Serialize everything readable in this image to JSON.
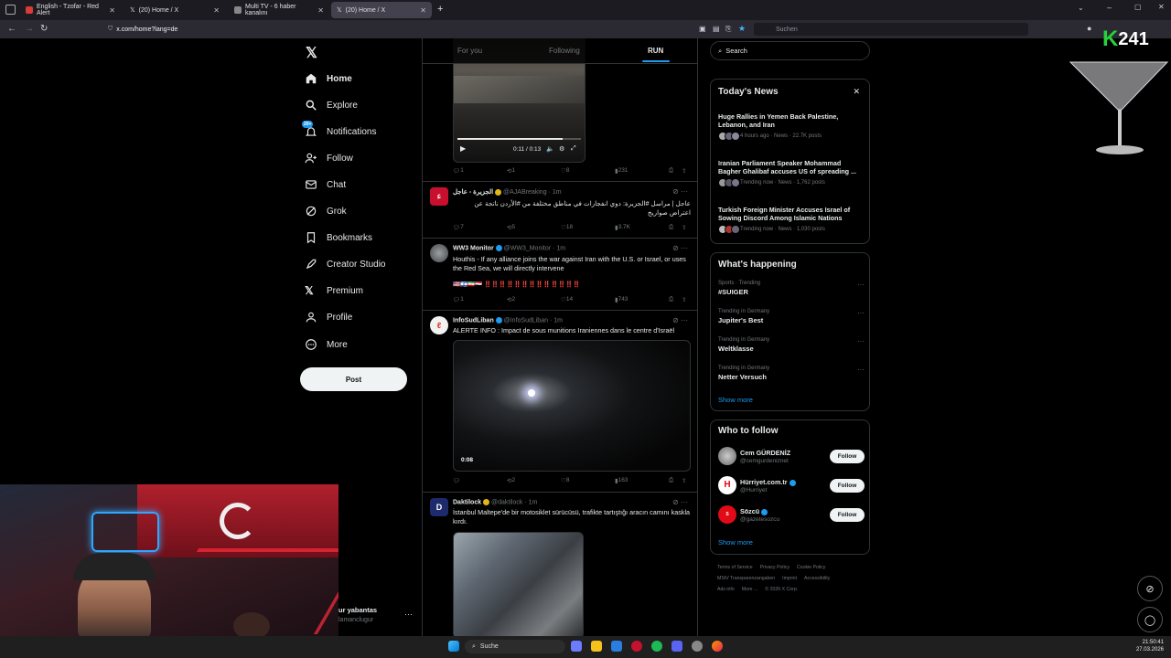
{
  "browser": {
    "tabs": [
      {
        "title": "English - Tzofar - Red Alert",
        "favicon_color": "#d93a3a"
      },
      {
        "title": "(20) Home / X",
        "favicon_color": "#ffffff"
      },
      {
        "title": "Multi TV - 6 haber kanalını",
        "favicon_color": "#888888"
      },
      {
        "title": "(20) Home / X",
        "favicon_color": "#ffffff"
      }
    ],
    "url": "x.com/home?lang=de",
    "search_placeholder": "Suchen"
  },
  "nav": {
    "items": [
      {
        "label": "Home",
        "icon": "home-icon"
      },
      {
        "label": "Explore",
        "icon": "search-icon"
      },
      {
        "label": "Notifications",
        "icon": "bell-icon",
        "badge": "20+"
      },
      {
        "label": "Follow",
        "icon": "add-user-icon"
      },
      {
        "label": "Chat",
        "icon": "mail-icon"
      },
      {
        "label": "Grok",
        "icon": "grok-icon"
      },
      {
        "label": "Bookmarks",
        "icon": "bookmark-icon"
      },
      {
        "label": "Creator Studio",
        "icon": "rocket-icon"
      },
      {
        "label": "Premium",
        "icon": "x-logo-icon"
      },
      {
        "label": "Profile",
        "icon": "profile-icon"
      },
      {
        "label": "More",
        "icon": "more-circle-icon"
      }
    ],
    "post_label": "Post",
    "account_name": "ur yabantas",
    "account_handle": "lamanclugur"
  },
  "feed": {
    "tabs": [
      "For you",
      "Following",
      "RUN"
    ],
    "tweet0": {
      "video_time": "0:11 / 0:13",
      "replies": "1",
      "reposts": "1",
      "likes": "8",
      "views": "231"
    },
    "tweet1": {
      "name": "الجزيرة - عاجل",
      "handle": "@AJABreaking",
      "time": "1m",
      "text": "عاجل | مراسل #الجزيرة: دوي انفجارات في مناطق مختلفة من #الأردن ناتجة عن اعتراض صواريخ",
      "replies": "7",
      "reposts": "5",
      "likes": "18",
      "views": "3.7K"
    },
    "tweet2": {
      "name": "WW3 Monitor",
      "handle": "@WW3_Monitor",
      "time": "1m",
      "text": "Houthis - If any alliance joins the war against Iran with the U.S. or Israel, or uses the Red Sea, we will directly intervene",
      "emojis": "🇺🇸🇮🇱🇮🇷🇾🇪 ‼️‼️‼️‼️‼️‼️‼️‼️‼️‼️‼️‼️‼️",
      "replies": "1",
      "reposts": "2",
      "likes": "14",
      "views": "743"
    },
    "tweet3": {
      "name": "InfoSudLiban",
      "handle": "@InfoSudLiban",
      "time": "1m",
      "text": "ALERTE INFO : Impact de sous munitions Iraniennes dans le centre d'Israël",
      "video_duration": "0:08",
      "replies": "",
      "reposts": "2",
      "likes": "8",
      "views": "163"
    },
    "tweet4": {
      "name": "Daktilock",
      "handle": "@daktilock",
      "time": "1m",
      "text": "İstanbul Maltepe'de bir motosiklet sürücüsü, trafikte tartıştığı aracın camını kaskla kırdı."
    }
  },
  "right": {
    "search_placeholder": "Search",
    "news": {
      "title": "Today's News",
      "items": [
        {
          "title": "Huge Rallies in Yemen Back Palestine, Lebanon, and Iran",
          "meta": "4 hours ago · News · 22.7K posts"
        },
        {
          "title": "Iranian Parliament Speaker Mohammad Bagher Ghalibaf accuses US of spreading ...",
          "meta": "Trending now · News · 1,762 posts"
        },
        {
          "title": "Turkish Foreign Minister Accuses Israel of Sowing Discord Among Islamic Nations",
          "meta": "Trending now · News · 1,030 posts"
        }
      ]
    },
    "happening": {
      "title": "What's happening",
      "trends": [
        {
          "context": "Sports · Trending",
          "name": "#SUIGER"
        },
        {
          "context": "Trending in Germany",
          "name": "Jupiter's Best"
        },
        {
          "context": "Trending in Germany",
          "name": "Weltklasse"
        },
        {
          "context": "Trending in Germany",
          "name": "Netter Versuch"
        }
      ],
      "show_more": "Show more"
    },
    "who_to_follow": {
      "title": "Who to follow",
      "accounts": [
        {
          "name": "Cem GÜRDENİZ",
          "handle": "@cemgurdeniznet",
          "follow": "Follow"
        },
        {
          "name": "Hürriyet.com.tr",
          "handle": "@Hurriyet",
          "follow": "Follow"
        },
        {
          "name": "Sözcü",
          "handle": "@gazetesozcu",
          "follow": "Follow"
        }
      ],
      "show_more": "Show more"
    },
    "footer": [
      "Terms of Service",
      "Privacy Policy",
      "Cookie Policy",
      "MStV Transparenzangaben",
      "Imprint",
      "Accessibility",
      "Ads info",
      "More ...",
      "© 2026 X Corp."
    ]
  },
  "overlay": {
    "logo_text": "241"
  },
  "taskbar": {
    "search_label": "Suche",
    "time": "21:50:41",
    "date": "27.03.2026"
  }
}
